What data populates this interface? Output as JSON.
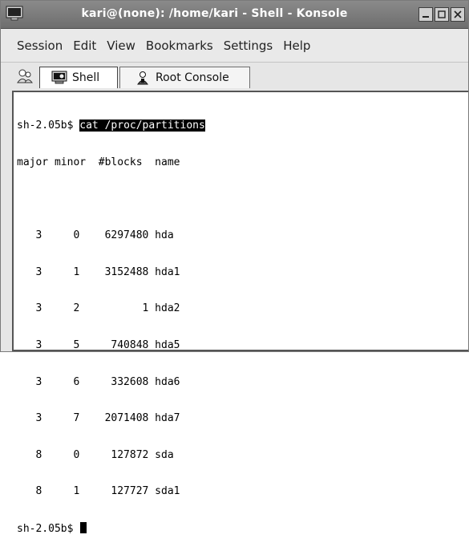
{
  "window": {
    "title": "kari@(none): /home/kari - Shell - Konsole"
  },
  "menubar": {
    "items": [
      "Session",
      "Edit",
      "View",
      "Bookmarks",
      "Settings",
      "Help"
    ]
  },
  "tabs": [
    {
      "label": "Shell",
      "icon": "terminal-icon",
      "active": true
    },
    {
      "label": "Root Console",
      "icon": "root-user-icon",
      "active": false
    }
  ],
  "terminal": {
    "prompt": "sh-2.05b$",
    "command": "cat /proc/partitions",
    "header": "major minor  #blocks  name",
    "rows": [
      "",
      "   3     0    6297480 hda",
      "   3     1    3152488 hda1",
      "   3     2          1 hda2",
      "   3     5     740848 hda5",
      "   3     6     332608 hda6",
      "   3     7    2071408 hda7",
      "   8     0     127872 sda",
      "   8     1     127727 sda1"
    ],
    "final_prompt": "sh-2.05b$"
  }
}
